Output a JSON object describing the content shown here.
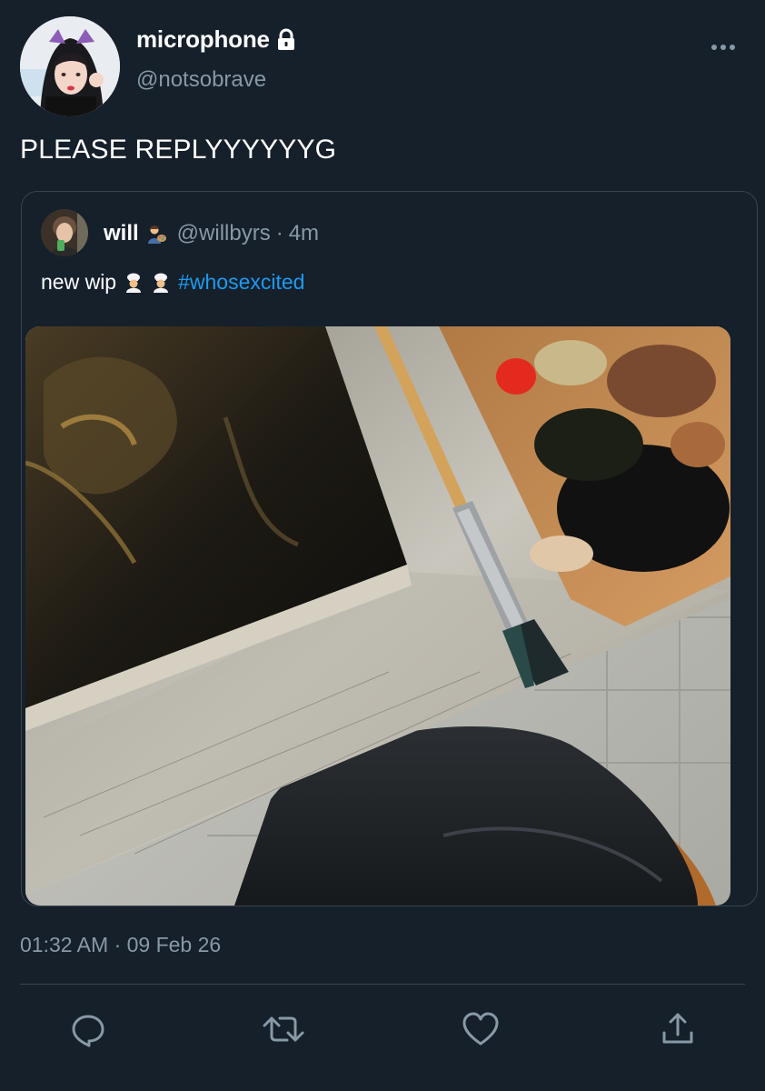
{
  "tweet": {
    "display_name": "microphone",
    "handle": "@notsobrave",
    "protected_icon": "lock-icon",
    "text": "PLEASE REPLYYYYYYG",
    "timestamp": "01:32 AM · 09 Feb 26"
  },
  "quoted_tweet": {
    "display_name": "will",
    "name_emoji": "artist-emoji",
    "handle": "@willbyrs",
    "separator": "·",
    "time_ago": "4m",
    "text": "new wip",
    "text_emojis": [
      "cook-emoji",
      "cook-emoji"
    ],
    "hashtag": "#whosexcited",
    "image": "photo of oil painting in progress with palette and brush"
  },
  "actions": [
    {
      "name": "reply",
      "icon": "reply-icon"
    },
    {
      "name": "retweet",
      "icon": "retweet-icon"
    },
    {
      "name": "like",
      "icon": "heart-icon"
    },
    {
      "name": "share",
      "icon": "share-icon"
    }
  ],
  "colors": {
    "background": "#15202b",
    "secondary_text": "#8899a6",
    "border": "#38444d",
    "link": "#1d9bf0"
  }
}
